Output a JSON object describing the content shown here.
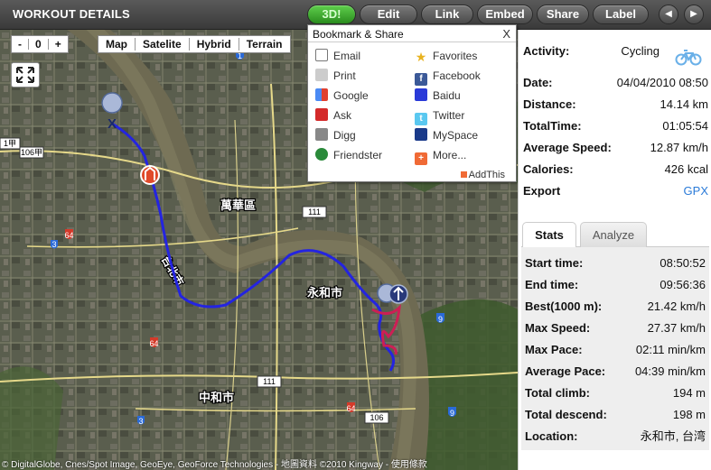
{
  "header": {
    "title": "WORKOUT DETAILS",
    "buttons": [
      "3D!",
      "Edit",
      "Link",
      "Embed",
      "Share",
      "Label"
    ],
    "prev_glyph": "◀",
    "next_glyph": "▶",
    "accent_color": "#3aa52a"
  },
  "map": {
    "zoom_minus": "-",
    "zoom_reset": "0",
    "zoom_plus": "+",
    "types": [
      "Map",
      "Satelite",
      "Hybrid",
      "Terrain"
    ],
    "copyright": "© DigitalGlobe, Cnes/Spot Image, GeoEye, GeoForce Technologies - 地圖資料 ©2010 Kingway - 使用條款",
    "route_color": "#2424e0",
    "labels": [
      "萬華區",
      "永和市",
      "中和市",
      "台北市",
      "106",
      "111",
      "64",
      "3",
      "9",
      "1甲",
      "106甲"
    ]
  },
  "bookmark": {
    "title": "Bookmark & Share",
    "close": "X",
    "items": [
      {
        "label": "Email",
        "icon": "email-icon"
      },
      {
        "label": "Favorites",
        "icon": "star-icon"
      },
      {
        "label": "Print",
        "icon": "print-icon"
      },
      {
        "label": "Facebook",
        "icon": "facebook-icon"
      },
      {
        "label": "Google",
        "icon": "google-icon"
      },
      {
        "label": "Baidu",
        "icon": "baidu-icon"
      },
      {
        "label": "Ask",
        "icon": "ask-icon"
      },
      {
        "label": "Twitter",
        "icon": "twitter-icon"
      },
      {
        "label": "Digg",
        "icon": "digg-icon"
      },
      {
        "label": "MySpace",
        "icon": "myspace-icon"
      },
      {
        "label": "Friendster",
        "icon": "friendster-icon"
      },
      {
        "label": "More...",
        "icon": "more-icon"
      }
    ],
    "footer": "AddThis"
  },
  "details": {
    "activity_label": "Activity:",
    "activity_value": "Cycling",
    "date_label": "Date:",
    "date_value": "04/04/2010 08:50",
    "distance_label": "Distance:",
    "distance_value": "14.14 km",
    "totaltime_label": "TotalTime:",
    "totaltime_value": "01:05:54",
    "avgspeed_label": "Average Speed:",
    "avgspeed_value": "12.87 km/h",
    "calories_label": "Calories:",
    "calories_value": "426 kcal",
    "export_label": "Export",
    "export_value": "GPX"
  },
  "tabs": {
    "stats": "Stats",
    "analyze": "Analyze"
  },
  "stats": [
    {
      "label": "Start time:",
      "value": "08:50:52"
    },
    {
      "label": "End time:",
      "value": "09:56:36"
    },
    {
      "label": "Best(1000 m):",
      "value": "21.42 km/h"
    },
    {
      "label": "Max Speed:",
      "value": "27.37 km/h"
    },
    {
      "label": "Max Pace:",
      "value": "02:11 min/km"
    },
    {
      "label": "Average Pace:",
      "value": "04:39 min/km"
    },
    {
      "label": "Total climb:",
      "value": "194 m"
    },
    {
      "label": "Total descend:",
      "value": "198 m"
    },
    {
      "label": "Location:",
      "value": "永和市, 台湾"
    }
  ]
}
